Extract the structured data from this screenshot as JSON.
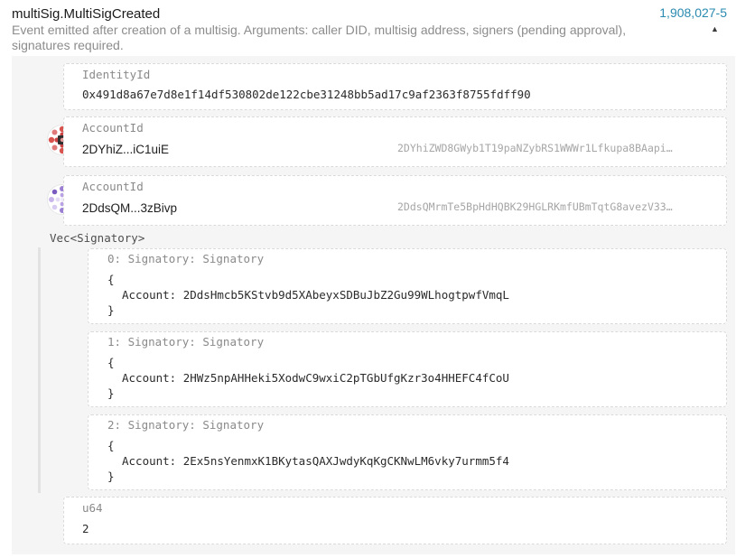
{
  "event": {
    "title": "multiSig.MultiSigCreated",
    "block_ref": "1,908,027-5",
    "description": "Event emitted after creation of a multisig. Arguments: caller DID, multisig address, signers (pending approval), signatures required.",
    "collapse_glyph": "▲"
  },
  "params": {
    "identity": {
      "type": "IdentityId",
      "value": "0x491d8a67e7d8e1f14df530802de122cbe31248bb5ad17c9af2363f8755fdff90"
    },
    "account1": {
      "type": "AccountId",
      "short": "2DYhiZ...iC1uiE",
      "full": "2DYhiZWD8GWyb1T19paNZybRS1WWWr1Lfkupa8BAapi…"
    },
    "account2": {
      "type": "AccountId",
      "short": "2DdsQM...3zBivp",
      "full": "2DdsQMrmTe5BpHdHQBK29HGLRKmfUBmTqtG8avezV33…"
    },
    "signatories": {
      "type": "Vec<Signatory>",
      "items": [
        {
          "label": "0: Signatory: Signatory",
          "open": "{",
          "line": "Account: 2DdsHmcb5KStvb9d5XAbeyxSDBuJbZ2Gu99WLhogtpwfVmqL",
          "close": "}"
        },
        {
          "label": "1: Signatory: Signatory",
          "open": "{",
          "line": "Account: 2HWz5npAHHeki5XodwC9wxiC2pTGbUfgKzr3o4HHEFC4fCoU",
          "close": "}"
        },
        {
          "label": "2: Signatory: Signatory",
          "open": "{",
          "line": "Account: 2Ex5nsYenmxK1BKytasQAXJwdyKqKgCKNwLM6vky7urmm5f4",
          "close": "}"
        }
      ]
    },
    "required": {
      "type": "u64",
      "value": "2"
    }
  },
  "colors": {
    "link": "#2a8ab0",
    "panel": "#f5f5f5",
    "border": "#dadada"
  },
  "icons": {
    "collapse": "caret-up-icon",
    "avatar1": "identicon",
    "avatar2": "identicon"
  }
}
